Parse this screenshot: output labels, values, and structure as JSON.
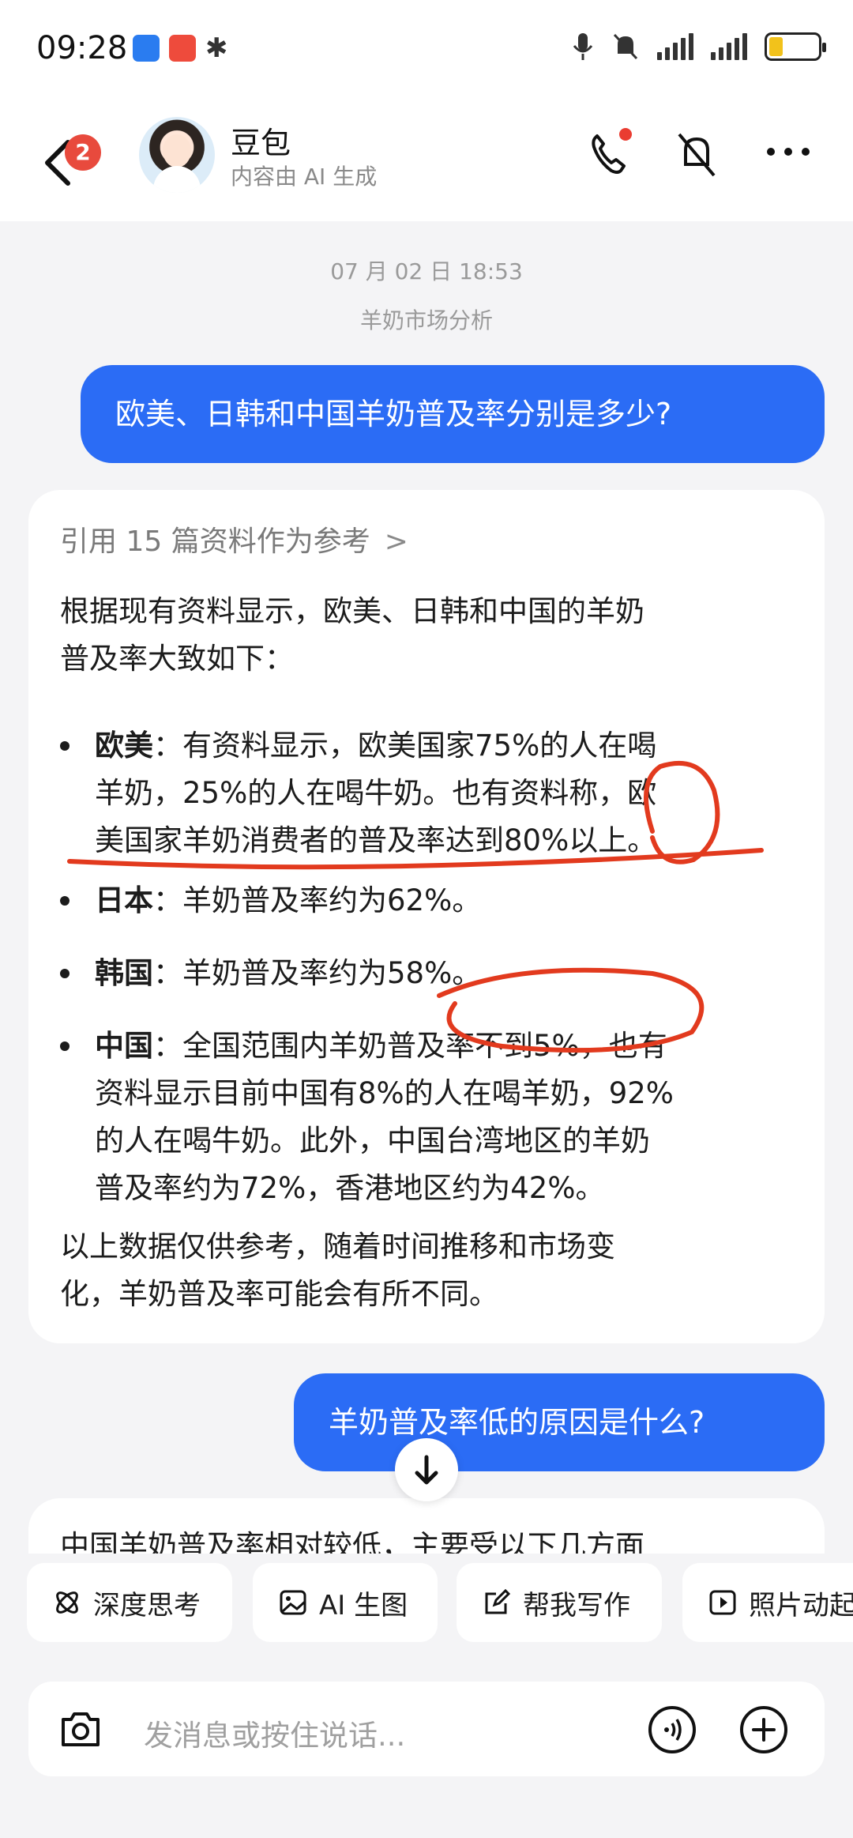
{
  "status_bar": {
    "time": "09:28"
  },
  "header": {
    "back_badge": "2",
    "bot_name": "豆包",
    "bot_subtitle": "内容由 AI 生成"
  },
  "chat": {
    "timestamp": "07 月 02 日 18:53",
    "topic": "羊奶市场分析",
    "user_message_1": "欧美、日韩和中国羊奶普及率分别是多少?",
    "ai_reply": {
      "references": "引用 15 篇资料作为参考",
      "intro_line1": "根据现有资料显示，欧美、日韩和中国的羊奶",
      "intro_line2": "普及率大致如下：",
      "bullets": [
        {
          "region": "欧美",
          "line1": "：有资料显示，欧美国家75%的人在喝",
          "line2": "羊奶，25%的人在喝牛奶。也有资料称，欧",
          "line3": "美国家羊奶消费者的普及率达到80%以上。"
        },
        {
          "region": "日本",
          "line1": "：羊奶普及率约为62%。"
        },
        {
          "region": "韩国",
          "line1": "：羊奶普及率约为58%。"
        },
        {
          "region": "中国",
          "line1": "：全国范围内羊奶普及率不到5%，也有",
          "line2": "资料显示目前中国有8%的人在喝羊奶，92%",
          "line3": "的人在喝牛奶。此外，中国台湾地区的羊奶",
          "line4": "普及率约为72%，香港地区约为42%。"
        }
      ],
      "outro_line1": "以上数据仅供参考，随着时间推移和市场变",
      "outro_line2": "化，羊奶普及率可能会有所不同。"
    },
    "user_message_2": "羊奶普及率低的原因是什么?",
    "partial_reply": "中国羊奶普及率相对较低，主要受以下几方面"
  },
  "quick_actions": [
    {
      "label": "深度思考",
      "icon": "atom-icon"
    },
    {
      "label": "AI 生图",
      "icon": "image-icon"
    },
    {
      "label": "帮我写作",
      "icon": "edit-icon"
    },
    {
      "label": "照片动起来",
      "icon": "play-icon"
    }
  ],
  "input": {
    "placeholder": "发消息或按住说话..."
  },
  "colors": {
    "accent": "#2b6cf5",
    "annotation_red": "#e23a1e",
    "badge_red": "#e84a3d"
  }
}
